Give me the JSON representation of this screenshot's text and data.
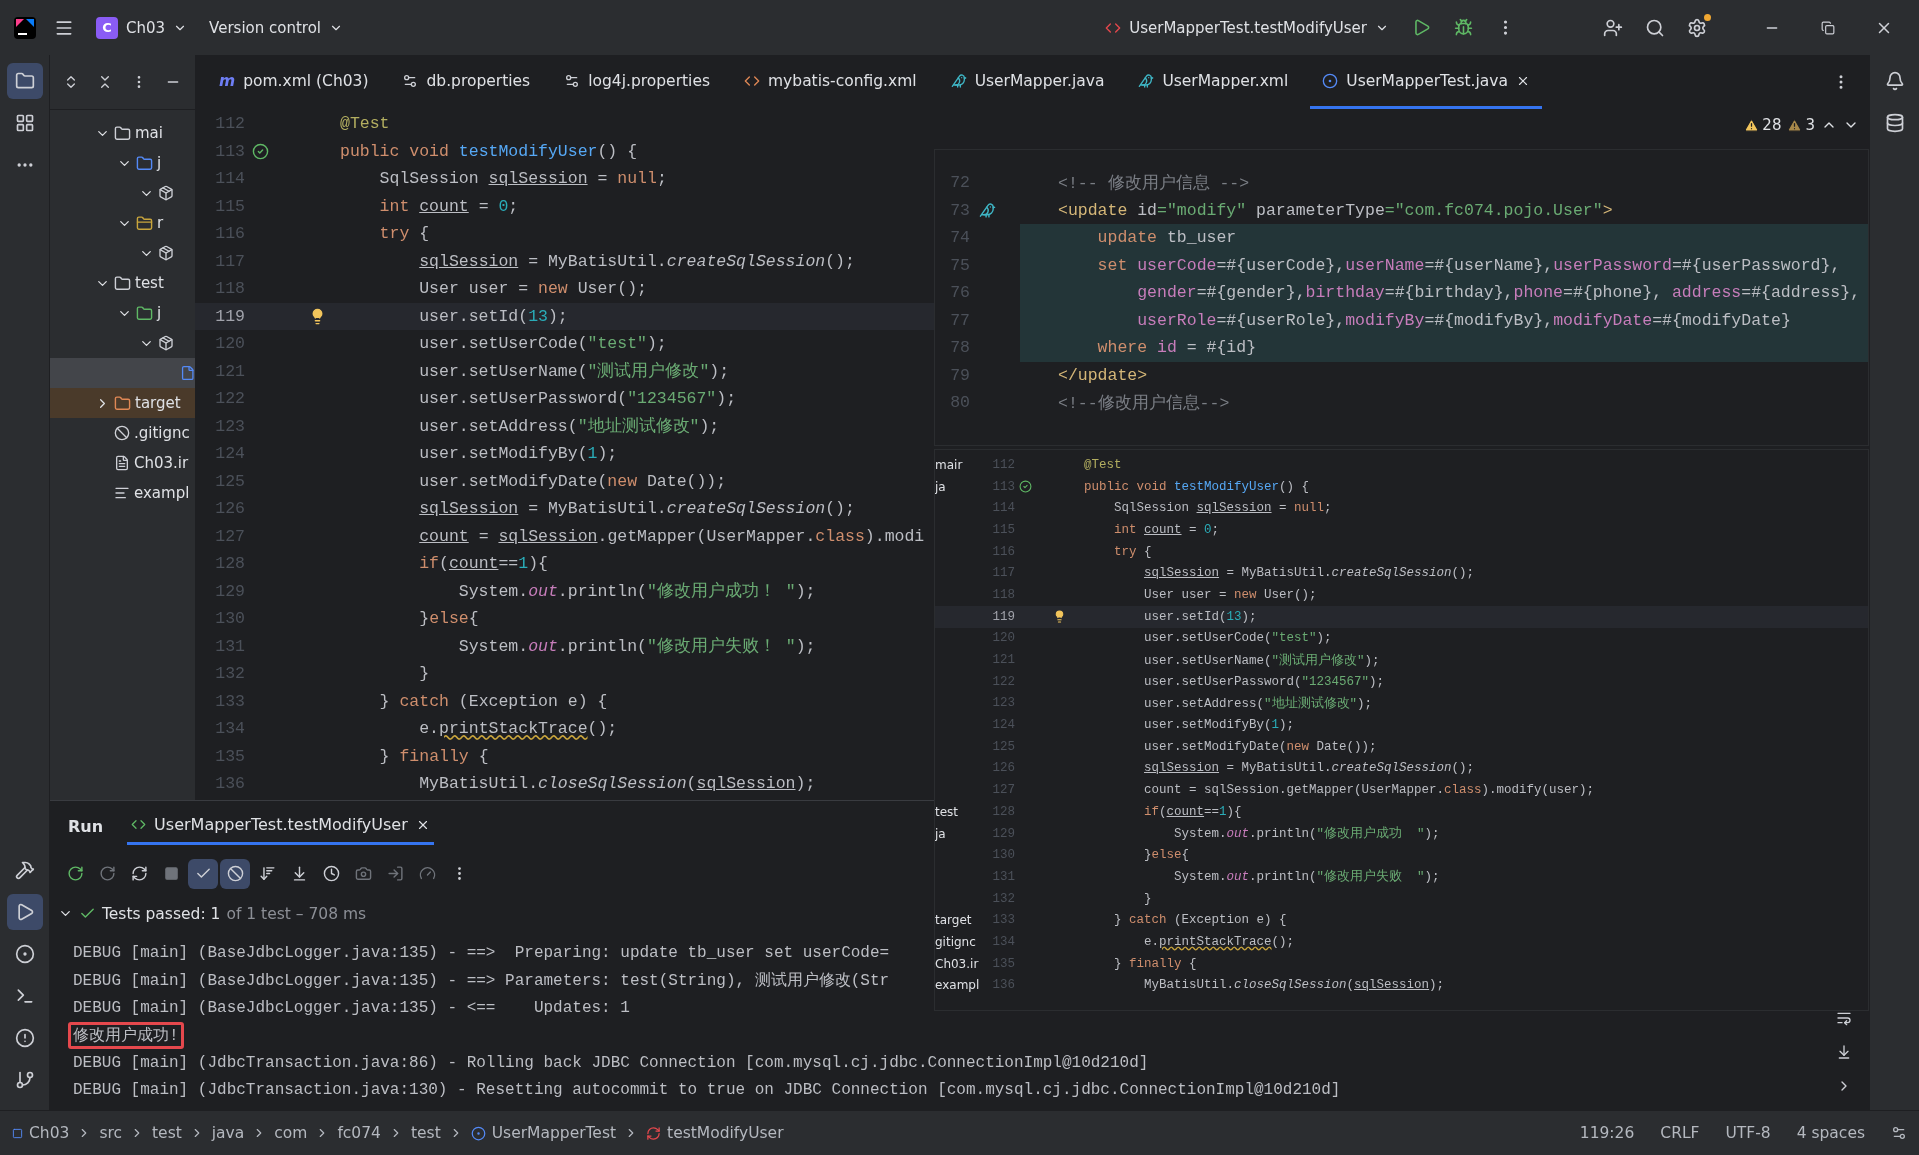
{
  "title_bar": {
    "project_badge": "C",
    "project": "Ch03",
    "vcs": "Version control",
    "run_config": "UserMapperTest.testModifyUser"
  },
  "tool_strip_top": [
    {
      "kind": "project",
      "selected": true
    },
    {
      "kind": "structure",
      "selected": false
    },
    {
      "kind": "more",
      "selected": false
    }
  ],
  "tool_strip_bottom": [
    {
      "kind": "build",
      "selected": false
    },
    {
      "kind": "run",
      "selected": true
    },
    {
      "kind": "services",
      "selected": false
    },
    {
      "kind": "terminal",
      "selected": false
    },
    {
      "kind": "problems",
      "selected": false
    },
    {
      "kind": "git",
      "selected": false
    }
  ],
  "editor_tabs": [
    {
      "label": "pom.xml (Ch03)",
      "kind": "maven",
      "icon_text": "m",
      "selected": false
    },
    {
      "label": "db.properties",
      "kind": "properties",
      "selected": false
    },
    {
      "label": "log4j.properties",
      "kind": "properties",
      "selected": false
    },
    {
      "label": "mybatis-config.xml",
      "kind": "xml",
      "selected": false
    },
    {
      "label": "UserMapper.java",
      "kind": "mapper",
      "selected": false
    },
    {
      "label": "UserMapper.xml",
      "kind": "mapper",
      "selected": false
    },
    {
      "label": "UserMapperTest.java",
      "kind": "class",
      "selected": true
    }
  ],
  "project_tree": [
    {
      "label": "mai",
      "kind": "folder",
      "expanded": true,
      "selected": false,
      "children": [
        {
          "label": "j",
          "kind": "source",
          "expanded": true,
          "selected": false,
          "children": [
            {
              "kind": "package",
              "expanded": true,
              "selected": false
            }
          ]
        },
        {
          "label": "r",
          "kind": "resources",
          "expanded": true,
          "selected": false,
          "children": [
            {
              "kind": "package",
              "expanded": true,
              "selected": false
            }
          ]
        }
      ]
    },
    {
      "label": "test",
      "kind": "folder",
      "expanded": true,
      "selected": false,
      "children": [
        {
          "label": "j",
          "kind": "test_source",
          "expanded": true,
          "selected": false,
          "children": [
            {
              "kind": "package",
              "expanded": true,
              "selected": false,
              "children": [
                {
                  "kind": "class",
                  "selected": true
                }
              ]
            }
          ]
        }
      ]
    },
    {
      "label": "target",
      "kind": "excluded",
      "expanded": false,
      "selected": false
    },
    {
      "label": ".gitignc",
      "kind": "ignore",
      "selected": false
    },
    {
      "label": "Ch03.ir",
      "kind": "module",
      "selected": false
    },
    {
      "label": "exampl",
      "kind": "text",
      "selected": false
    }
  ],
  "inspections": {
    "warnings": "28",
    "weak_warnings": "3"
  },
  "editor": {
    "lines": [
      {
        "number": "112",
        "kind": "code",
        "current": false,
        "segs": [
          {
            "kind": "anno",
            "text": "@Test"
          }
        ]
      },
      {
        "number": "113",
        "kind": "run",
        "current": false,
        "segs": [
          {
            "kind": "kw",
            "text": "public void "
          },
          {
            "kind": "fn",
            "text": "testModifyUser"
          },
          {
            "kind": "p",
            "text": "() {"
          }
        ]
      },
      {
        "number": "114",
        "kind": "code",
        "current": false,
        "segs": [
          {
            "kind": "p",
            "text": "    SqlSession "
          },
          {
            "kind": "ul",
            "text": "sqlSession"
          },
          {
            "kind": "p",
            "text": " = "
          },
          {
            "kind": "kw",
            "text": "null"
          },
          {
            "kind": "p",
            "text": ";"
          }
        ]
      },
      {
        "number": "115",
        "kind": "code",
        "current": false,
        "segs": [
          {
            "kind": "kw",
            "text": "    int "
          },
          {
            "kind": "ul",
            "text": "count"
          },
          {
            "kind": "p",
            "text": " = "
          },
          {
            "kind": "num",
            "text": "0"
          },
          {
            "kind": "p",
            "text": ";"
          }
        ]
      },
      {
        "number": "116",
        "kind": "code",
        "current": false,
        "segs": [
          {
            "kind": "kw",
            "text": "    try "
          },
          {
            "kind": "p",
            "text": "{"
          }
        ]
      },
      {
        "number": "117",
        "kind": "code",
        "current": false,
        "segs": [
          {
            "kind": "ul",
            "text": "        sqlSession"
          },
          {
            "kind": "p",
            "text": " = MyBatisUtil."
          },
          {
            "kind": "it",
            "text": "createSqlSession"
          },
          {
            "kind": "p",
            "text": "();"
          }
        ]
      },
      {
        "number": "118",
        "kind": "code",
        "current": false,
        "segs": [
          {
            "kind": "p",
            "text": "        User user = "
          },
          {
            "kind": "kw",
            "text": "new "
          },
          {
            "kind": "p",
            "text": "User();"
          }
        ]
      },
      {
        "number": "119",
        "kind": "bulb",
        "current": true,
        "segs": [
          {
            "kind": "p",
            "text": "        user.setId("
          },
          {
            "kind": "num",
            "text": "13"
          },
          {
            "kind": "p",
            "text": ");"
          }
        ]
      },
      {
        "number": "120",
        "kind": "code",
        "current": false,
        "segs": [
          {
            "kind": "p",
            "text": "        user.setUserCode("
          },
          {
            "kind": "str",
            "text": "\"test\""
          },
          {
            "kind": "p",
            "text": ");"
          }
        ]
      },
      {
        "number": "121",
        "kind": "code",
        "current": false,
        "segs": [
          {
            "kind": "p",
            "text": "        user.setUserName("
          },
          {
            "kind": "str",
            "text": "\"测试用户修改\""
          },
          {
            "kind": "p",
            "text": ");"
          }
        ]
      },
      {
        "number": "122",
        "kind": "code",
        "current": false,
        "segs": [
          {
            "kind": "p",
            "text": "        user.setUserPassword("
          },
          {
            "kind": "str",
            "text": "\"1234567\""
          },
          {
            "kind": "p",
            "text": ");"
          }
        ]
      },
      {
        "number": "123",
        "kind": "code",
        "current": false,
        "segs": [
          {
            "kind": "p",
            "text": "        user.setAddress("
          },
          {
            "kind": "str",
            "text": "\"地址测试修改\""
          },
          {
            "kind": "p",
            "text": ");"
          }
        ]
      },
      {
        "number": "124",
        "kind": "code",
        "current": false,
        "segs": [
          {
            "kind": "p",
            "text": "        user.setModifyBy("
          },
          {
            "kind": "num",
            "text": "1"
          },
          {
            "kind": "p",
            "text": ");"
          }
        ]
      },
      {
        "number": "125",
        "kind": "code",
        "current": false,
        "segs": [
          {
            "kind": "p",
            "text": "        user.setModifyDate("
          },
          {
            "kind": "kw",
            "text": "new "
          },
          {
            "kind": "p",
            "text": "Date());"
          }
        ]
      },
      {
        "number": "126",
        "kind": "code",
        "current": false,
        "segs": [
          {
            "kind": "ul",
            "text": "        sqlSession"
          },
          {
            "kind": "p",
            "text": " = MyBatisUtil."
          },
          {
            "kind": "it",
            "text": "createSqlSession"
          },
          {
            "kind": "p",
            "text": "();"
          }
        ]
      },
      {
        "number": "127",
        "kind": "code",
        "current": false,
        "segs": [
          {
            "kind": "ul",
            "text": "        count"
          },
          {
            "kind": "p",
            "text": " = "
          },
          {
            "kind": "ul",
            "text": "sqlSession"
          },
          {
            "kind": "p",
            "text": ".getMapper(UserMapper."
          },
          {
            "kind": "kw",
            "text": "class"
          },
          {
            "kind": "p",
            "text": ").modi"
          }
        ]
      },
      {
        "number": "128",
        "kind": "code",
        "current": false,
        "segs": [
          {
            "kind": "kw",
            "text": "        if"
          },
          {
            "kind": "p",
            "text": "("
          },
          {
            "kind": "ul",
            "text": "count"
          },
          {
            "kind": "p",
            "text": "=="
          },
          {
            "kind": "num",
            "text": "1"
          },
          {
            "kind": "p",
            "text": "){"
          }
        ]
      },
      {
        "number": "129",
        "kind": "code",
        "current": false,
        "segs": [
          {
            "kind": "p",
            "text": "            System."
          },
          {
            "kind": "field",
            "text": "out"
          },
          {
            "kind": "p",
            "text": ".println("
          },
          {
            "kind": "str",
            "text": "\"修改用户成功！ \""
          },
          {
            "kind": "p",
            "text": ");"
          }
        ]
      },
      {
        "number": "130",
        "kind": "code",
        "current": false,
        "segs": [
          {
            "kind": "p",
            "text": "        }"
          },
          {
            "kind": "kw",
            "text": "else"
          },
          {
            "kind": "p",
            "text": "{"
          }
        ]
      },
      {
        "number": "131",
        "kind": "code",
        "current": false,
        "segs": [
          {
            "kind": "p",
            "text": "            System."
          },
          {
            "kind": "field",
            "text": "out"
          },
          {
            "kind": "p",
            "text": ".println("
          },
          {
            "kind": "str",
            "text": "\"修改用户失败！ \""
          },
          {
            "kind": "p",
            "text": ");"
          }
        ]
      },
      {
        "number": "132",
        "kind": "code",
        "current": false,
        "segs": [
          {
            "kind": "p",
            "text": "        }"
          }
        ]
      },
      {
        "number": "133",
        "kind": "code",
        "current": false,
        "segs": [
          {
            "kind": "p",
            "text": "    } "
          },
          {
            "kind": "kw",
            "text": "catch"
          },
          {
            "kind": "p",
            "text": " (Exception e) {"
          }
        ]
      },
      {
        "number": "134",
        "kind": "code",
        "current": false,
        "segs": [
          {
            "kind": "p",
            "text": "        e."
          },
          {
            "kind": "warn",
            "text": "printStackTrace"
          },
          {
            "kind": "p",
            "text": "();"
          }
        ]
      },
      {
        "number": "135",
        "kind": "code",
        "current": false,
        "segs": [
          {
            "kind": "p",
            "text": "    } "
          },
          {
            "kind": "kw",
            "text": "finally"
          },
          {
            "kind": "p",
            "text": " {"
          }
        ]
      },
      {
        "number": "136",
        "kind": "code",
        "current": false,
        "segs": [
          {
            "kind": "p",
            "text": "        MyBatisUtil."
          },
          {
            "kind": "it",
            "text": "closeSqlSession"
          },
          {
            "kind": "p",
            "text": "("
          },
          {
            "kind": "ul",
            "text": "sqlSession"
          },
          {
            "kind": "p",
            "text": ");"
          }
        ]
      }
    ]
  },
  "run_panel": {
    "title": "Run",
    "tab": {
      "label": "UserMapperTest.testModifyUser",
      "selected": true
    },
    "toggles": [
      {
        "kind": "show_passed",
        "selected": true
      },
      {
        "kind": "show_ignored",
        "selected": true
      }
    ],
    "result": {
      "status": "Tests passed: 1",
      "detail": "of 1 test – 708 ms",
      "expanded": true
    },
    "log": [
      {
        "text": "DEBUG [main] (BaseJdbcLogger.java:135) - ==>  Preparing: update tb_user set userCode=",
        "highlighted": false
      },
      {
        "text": "DEBUG [main] (BaseJdbcLogger.java:135) - ==> Parameters: test(String), 测试用户修改(Str",
        "highlighted": false
      },
      {
        "text": "DEBUG [main] (BaseJdbcLogger.java:135) - <==    Updates: 1",
        "highlighted": false
      },
      {
        "text": "修改用户成功!",
        "highlighted": true
      },
      {
        "text": "DEBUG [main] (JdbcTransaction.java:86) - Rolling back JDBC Connection [com.mysql.cj.jdbc.ConnectionImpl@10d210d]",
        "highlighted": false
      },
      {
        "text": "DEBUG [main] (JdbcTransaction.java:130) - Resetting autocommit to true on JDBC Connection [com.mysql.cj.jdbc.ConnectionImpl@10d210d]",
        "highlighted": false
      }
    ]
  },
  "status_bar": {
    "breadcrumbs": [
      {
        "label": "Ch03",
        "kind": "module"
      },
      {
        "label": "src",
        "kind": "plain"
      },
      {
        "label": "test",
        "kind": "plain"
      },
      {
        "label": "java",
        "kind": "plain"
      },
      {
        "label": "com",
        "kind": "plain"
      },
      {
        "label": "fc074",
        "kind": "plain"
      },
      {
        "label": "test",
        "kind": "plain"
      },
      {
        "label": "UserMapperTest",
        "kind": "class"
      },
      {
        "label": "testModifyUser",
        "kind": "method"
      }
    ],
    "items": [
      "119:26",
      "CRLF",
      "UTF-8",
      "4 spaces"
    ]
  },
  "xml_snippet": {
    "lines": [
      {
        "number": "72",
        "kind": "code",
        "highlighted": false,
        "segs": [
          {
            "kind": "cm",
            "text": "<!-- 修改用户信息 -->"
          }
        ]
      },
      {
        "number": "73",
        "kind": "mapper",
        "highlighted": false,
        "segs": [
          {
            "kind": "tag",
            "text": "<update "
          },
          {
            "kind": "p",
            "text": "id"
          },
          {
            "kind": "str",
            "text": "=\"modify\" "
          },
          {
            "kind": "p",
            "text": "parameterType"
          },
          {
            "kind": "str",
            "text": "=\"com.fc074.pojo.User\""
          },
          {
            "kind": "tag",
            "text": ">"
          }
        ]
      },
      {
        "number": "74",
        "kind": "code",
        "highlighted": true,
        "segs": [
          {
            "kind": "sk",
            "text": "    update "
          },
          {
            "kind": "p",
            "text": "tb_user"
          }
        ]
      },
      {
        "number": "75",
        "kind": "code",
        "highlighted": true,
        "segs": [
          {
            "kind": "sk",
            "text": "    set "
          },
          {
            "kind": "sv",
            "text": "userCode"
          },
          {
            "kind": "p",
            "text": "=#{userCode},"
          },
          {
            "kind": "sv",
            "text": "userName"
          },
          {
            "kind": "p",
            "text": "=#{userName},"
          },
          {
            "kind": "sv",
            "text": "userPassword"
          },
          {
            "kind": "p",
            "text": "=#{userPassword},"
          }
        ]
      },
      {
        "number": "76",
        "kind": "code",
        "highlighted": true,
        "segs": [
          {
            "kind": "sv",
            "text": "        gender"
          },
          {
            "kind": "p",
            "text": "=#{gender},"
          },
          {
            "kind": "sv",
            "text": "birthday"
          },
          {
            "kind": "p",
            "text": "=#{birthday},"
          },
          {
            "kind": "sv",
            "text": "phone"
          },
          {
            "kind": "p",
            "text": "=#{phone}, "
          },
          {
            "kind": "sv",
            "text": "address"
          },
          {
            "kind": "p",
            "text": "=#{address},"
          }
        ]
      },
      {
        "number": "77",
        "kind": "code",
        "highlighted": true,
        "segs": [
          {
            "kind": "sv",
            "text": "        userRole"
          },
          {
            "kind": "p",
            "text": "=#{userRole},"
          },
          {
            "kind": "sv",
            "text": "modifyBy"
          },
          {
            "kind": "p",
            "text": "=#{modifyBy},"
          },
          {
            "kind": "sv",
            "text": "modifyDate"
          },
          {
            "kind": "p",
            "text": "=#{modifyDate}"
          }
        ]
      },
      {
        "number": "78",
        "kind": "code",
        "highlighted": true,
        "segs": [
          {
            "kind": "sk",
            "text": "    where "
          },
          {
            "kind": "sv",
            "text": "id"
          },
          {
            "kind": "p",
            "text": " = #{id}"
          }
        ]
      },
      {
        "number": "79",
        "kind": "code",
        "highlighted": false,
        "segs": [
          {
            "kind": "tag",
            "text": "</update>"
          }
        ]
      },
      {
        "number": "80",
        "kind": "code",
        "highlighted": false,
        "segs": [
          {
            "kind": "cm",
            "text": "<!--修改用户信息-->"
          }
        ]
      }
    ]
  },
  "code_snippet": {
    "lines": [
      {
        "number": "112",
        "tree": "mair",
        "kind": "code",
        "current": false,
        "segs": [
          {
            "kind": "anno",
            "text": "@Test"
          }
        ]
      },
      {
        "number": "113",
        "tree": "ja",
        "kind": "run",
        "current": false,
        "segs": [
          {
            "kind": "kw",
            "text": "public void "
          },
          {
            "kind": "fn",
            "text": "testModifyUser"
          },
          {
            "kind": "p",
            "text": "() {"
          }
        ]
      },
      {
        "number": "114",
        "kind": "code",
        "current": false,
        "segs": [
          {
            "kind": "p",
            "text": "    SqlSession "
          },
          {
            "kind": "ul",
            "text": "sqlSession"
          },
          {
            "kind": "p",
            "text": " = "
          },
          {
            "kind": "kw",
            "text": "null"
          },
          {
            "kind": "p",
            "text": ";"
          }
        ]
      },
      {
        "number": "115",
        "kind": "code",
        "current": false,
        "segs": [
          {
            "kind": "kw",
            "text": "    int "
          },
          {
            "kind": "ul",
            "text": "count"
          },
          {
            "kind": "p",
            "text": " = "
          },
          {
            "kind": "num",
            "text": "0"
          },
          {
            "kind": "p",
            "text": ";"
          }
        ]
      },
      {
        "number": "116",
        "kind": "code",
        "current": false,
        "segs": [
          {
            "kind": "kw",
            "text": "    try "
          },
          {
            "kind": "p",
            "text": "{"
          }
        ]
      },
      {
        "number": "117",
        "kind": "code",
        "current": false,
        "segs": [
          {
            "kind": "ul",
            "text": "        sqlSession"
          },
          {
            "kind": "p",
            "text": " = MyBatisUtil."
          },
          {
            "kind": "it",
            "text": "createSqlSession"
          },
          {
            "kind": "p",
            "text": "();"
          }
        ]
      },
      {
        "number": "118",
        "kind": "code",
        "current": false,
        "segs": [
          {
            "kind": "p",
            "text": "        User user = "
          },
          {
            "kind": "kw",
            "text": "new "
          },
          {
            "kind": "p",
            "text": "User();"
          }
        ]
      },
      {
        "number": "119",
        "kind": "bulb",
        "current": true,
        "segs": [
          {
            "kind": "p",
            "text": "        user.setId("
          },
          {
            "kind": "num",
            "text": "13"
          },
          {
            "kind": "p",
            "text": ");"
          }
        ]
      },
      {
        "number": "120",
        "kind": "code",
        "current": false,
        "segs": [
          {
            "kind": "p",
            "text": "        user.setUserCode("
          },
          {
            "kind": "str",
            "text": "\"test\""
          },
          {
            "kind": "p",
            "text": ");"
          }
        ]
      },
      {
        "number": "121",
        "kind": "code",
        "current": false,
        "segs": [
          {
            "kind": "p",
            "text": "        user.setUserName("
          },
          {
            "kind": "str",
            "text": "\"测试用户修改\""
          },
          {
            "kind": "p",
            "text": ");"
          }
        ]
      },
      {
        "number": "122",
        "kind": "code",
        "current": false,
        "segs": [
          {
            "kind": "p",
            "text": "        user.setUserPassword("
          },
          {
            "kind": "str",
            "text": "\"1234567\""
          },
          {
            "kind": "p",
            "text": ");"
          }
        ]
      },
      {
        "number": "123",
        "kind": "code",
        "current": false,
        "segs": [
          {
            "kind": "p",
            "text": "        user.setAddress("
          },
          {
            "kind": "str",
            "text": "\"地址测试修改\""
          },
          {
            "kind": "p",
            "text": ");"
          }
        ]
      },
      {
        "number": "124",
        "kind": "code",
        "current": false,
        "segs": [
          {
            "kind": "p",
            "text": "        user.setModifyBy("
          },
          {
            "kind": "num",
            "text": "1"
          },
          {
            "kind": "p",
            "text": ");"
          }
        ]
      },
      {
        "number": "125",
        "kind": "code",
        "current": false,
        "segs": [
          {
            "kind": "p",
            "text": "        user.setModifyDate("
          },
          {
            "kind": "kw",
            "text": "new "
          },
          {
            "kind": "p",
            "text": "Date());"
          }
        ]
      },
      {
        "number": "126",
        "kind": "code",
        "current": false,
        "segs": [
          {
            "kind": "ul",
            "text": "        sqlSession"
          },
          {
            "kind": "p",
            "text": " = MyBatisUtil."
          },
          {
            "kind": "it",
            "text": "createSqlSession"
          },
          {
            "kind": "p",
            "text": "();"
          }
        ]
      },
      {
        "number": "127",
        "kind": "code",
        "current": false,
        "segs": [
          {
            "kind": "p",
            "text": "        count = sqlSession.getMapper(UserMapper."
          },
          {
            "kind": "kw",
            "text": "class"
          },
          {
            "kind": "p",
            "text": ").modify(user);"
          }
        ]
      },
      {
        "number": "128",
        "tree": "test",
        "kind": "code",
        "current": false,
        "segs": [
          {
            "kind": "kw",
            "text": "        if"
          },
          {
            "kind": "p",
            "text": "("
          },
          {
            "kind": "ul",
            "text": "count"
          },
          {
            "kind": "p",
            "text": "=="
          },
          {
            "kind": "num",
            "text": "1"
          },
          {
            "kind": "p",
            "text": "){"
          }
        ]
      },
      {
        "number": "129",
        "tree": "ja",
        "kind": "code",
        "current": false,
        "segs": [
          {
            "kind": "p",
            "text": "            System."
          },
          {
            "kind": "field",
            "text": "out"
          },
          {
            "kind": "p",
            "text": ".println("
          },
          {
            "kind": "str",
            "text": "\"修改用户成功  \""
          },
          {
            "kind": "p",
            "text": ");"
          }
        ]
      },
      {
        "number": "130",
        "kind": "code",
        "current": false,
        "segs": [
          {
            "kind": "p",
            "text": "        }"
          },
          {
            "kind": "kw",
            "text": "else"
          },
          {
            "kind": "p",
            "text": "{"
          }
        ]
      },
      {
        "number": "131",
        "kind": "code",
        "current": false,
        "segs": [
          {
            "kind": "p",
            "text": "            System."
          },
          {
            "kind": "field",
            "text": "out"
          },
          {
            "kind": "p",
            "text": ".println("
          },
          {
            "kind": "str",
            "text": "\"修改用户失败  \""
          },
          {
            "kind": "p",
            "text": ");"
          }
        ]
      },
      {
        "number": "132",
        "kind": "code",
        "current": false,
        "segs": [
          {
            "kind": "p",
            "text": "        }"
          }
        ]
      },
      {
        "number": "133",
        "tree": "target",
        "kind": "code",
        "current": false,
        "segs": [
          {
            "kind": "p",
            "text": "    } "
          },
          {
            "kind": "kw",
            "text": "catch"
          },
          {
            "kind": "p",
            "text": " (Exception e) {"
          }
        ]
      },
      {
        "number": "134",
        "tree": "gitignc",
        "kind": "code",
        "current": false,
        "segs": [
          {
            "kind": "p",
            "text": "        e."
          },
          {
            "kind": "warn",
            "text": "printStackTrace"
          },
          {
            "kind": "p",
            "text": "();"
          }
        ]
      },
      {
        "number": "135",
        "tree": "Ch03.ir",
        "kind": "code",
        "current": false,
        "segs": [
          {
            "kind": "p",
            "text": "    } "
          },
          {
            "kind": "kw",
            "text": "finally"
          },
          {
            "kind": "p",
            "text": " {"
          }
        ]
      },
      {
        "number": "136",
        "tree": "exampl",
        "kind": "code",
        "current": false,
        "segs": [
          {
            "kind": "p",
            "text": "        MyBatisUtil."
          },
          {
            "kind": "it",
            "text": "closeSqlSession"
          },
          {
            "kind": "p",
            "text": "("
          },
          {
            "kind": "ul",
            "text": "sqlSession"
          },
          {
            "kind": "p",
            "text": ");"
          }
        ]
      }
    ]
  }
}
